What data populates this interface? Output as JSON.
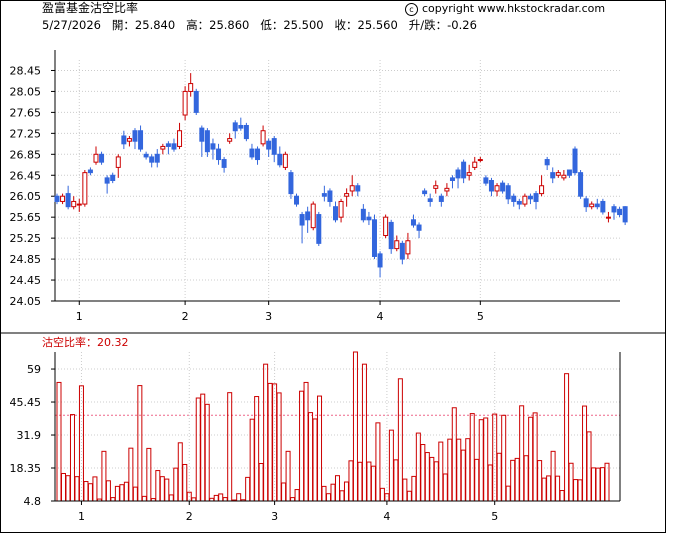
{
  "header": {
    "title": "盈富基金沽空比率",
    "copyright": "copyright www.hkstockradar.com",
    "ohlc_line": "5/27/2026   開：25.840   高：25.860   低：25.500   收：25.560   升/跌：-0.26"
  },
  "indicator": {
    "label": "沽空比率：20.32"
  },
  "colors": {
    "up": "#cc0000",
    "down": "#3366dd",
    "bar": "#cc0000",
    "grid": "#cccccc",
    "ref": "#ee6688"
  },
  "chart_data": [
    {
      "type": "candlestick",
      "title": "盈富基金沽空比率",
      "x_tick_labels": [
        "1",
        "2",
        "3",
        "4",
        "5"
      ],
      "x_tick_index": [
        4,
        23,
        38,
        58,
        76
      ],
      "y_ticks": [
        "28.45",
        "28.05",
        "27.65",
        "27.25",
        "26.85",
        "26.45",
        "26.05",
        "25.65",
        "25.25",
        "24.85",
        "24.45",
        "24.05"
      ],
      "ylim": [
        24.05,
        28.65
      ],
      "grid": true,
      "candles": [
        [
          26.05,
          25.95,
          26.1,
          25.9
        ],
        [
          25.95,
          26.05,
          26.1,
          25.9
        ],
        [
          26.1,
          25.85,
          26.25,
          25.8
        ],
        [
          25.85,
          25.95,
          26.05,
          25.8
        ],
        [
          25.9,
          25.9,
          26.0,
          25.75
        ],
        [
          25.9,
          26.5,
          26.55,
          25.85
        ],
        [
          26.55,
          26.5,
          26.6,
          26.45
        ],
        [
          26.7,
          26.85,
          27.0,
          26.65
        ],
        [
          26.85,
          26.7,
          26.9,
          26.65
        ],
        [
          26.4,
          26.3,
          26.45,
          26.1
        ],
        [
          26.45,
          26.35,
          26.5,
          26.3
        ],
        [
          26.6,
          26.8,
          26.85,
          26.4
        ],
        [
          27.2,
          27.05,
          27.3,
          26.95
        ],
        [
          27.1,
          27.15,
          27.2,
          27.0
        ],
        [
          27.3,
          27.1,
          27.35,
          26.95
        ],
        [
          27.3,
          26.95,
          27.4,
          26.9
        ],
        [
          26.85,
          26.8,
          26.9,
          26.75
        ],
        [
          26.8,
          26.7,
          26.85,
          26.6
        ],
        [
          26.85,
          26.7,
          26.95,
          26.6
        ],
        [
          26.95,
          27.0,
          27.05,
          26.85
        ],
        [
          27.05,
          27.0,
          27.1,
          26.85
        ],
        [
          27.05,
          26.95,
          27.15,
          26.9
        ],
        [
          27.0,
          27.3,
          27.45,
          26.95
        ],
        [
          27.6,
          28.05,
          28.15,
          27.5
        ],
        [
          28.05,
          28.2,
          28.4,
          27.95
        ],
        [
          28.05,
          27.65,
          28.1,
          27.6
        ],
        [
          27.35,
          27.1,
          27.4,
          26.8
        ],
        [
          27.3,
          26.9,
          27.35,
          26.8
        ],
        [
          27.05,
          26.95,
          27.15,
          26.75
        ],
        [
          26.95,
          26.75,
          27.05,
          26.65
        ],
        [
          26.75,
          26.6,
          26.8,
          26.5
        ],
        [
          27.1,
          27.15,
          27.25,
          27.05
        ],
        [
          27.45,
          27.3,
          27.5,
          27.15
        ],
        [
          27.4,
          27.35,
          27.55,
          27.3
        ],
        [
          27.4,
          27.15,
          27.45,
          27.1
        ],
        [
          26.95,
          26.8,
          27.05,
          26.75
        ],
        [
          26.95,
          26.75,
          27.0,
          26.65
        ],
        [
          27.05,
          27.3,
          27.4,
          27.0
        ],
        [
          27.1,
          26.95,
          27.15,
          26.8
        ],
        [
          27.15,
          26.85,
          27.2,
          26.7
        ],
        [
          26.85,
          26.65,
          27.0,
          26.6
        ],
        [
          26.6,
          26.85,
          26.9,
          26.55
        ],
        [
          26.5,
          26.1,
          26.55,
          26.0
        ],
        [
          26.05,
          25.9,
          26.1,
          25.85
        ],
        [
          25.7,
          25.5,
          25.75,
          25.15
        ],
        [
          25.75,
          25.6,
          25.85,
          25.35
        ],
        [
          25.45,
          25.9,
          25.95,
          25.4
        ],
        [
          25.7,
          25.15,
          25.75,
          25.1
        ],
        [
          26.1,
          26.05,
          26.25,
          25.95
        ],
        [
          26.15,
          25.95,
          26.2,
          25.85
        ],
        [
          25.85,
          25.6,
          25.95,
          25.55
        ],
        [
          25.65,
          25.95,
          26.0,
          25.55
        ],
        [
          26.05,
          26.1,
          26.2,
          25.85
        ],
        [
          26.15,
          26.25,
          26.45,
          26.05
        ],
        [
          26.25,
          26.15,
          26.3,
          26.05
        ],
        [
          25.8,
          25.6,
          25.9,
          25.55
        ],
        [
          25.65,
          25.6,
          25.75,
          25.5
        ],
        [
          25.6,
          24.9,
          25.7,
          24.85
        ],
        [
          24.95,
          24.7,
          25.0,
          24.5
        ],
        [
          25.3,
          25.65,
          25.7,
          25.25
        ],
        [
          25.55,
          25.05,
          25.6,
          24.95
        ],
        [
          25.05,
          25.2,
          25.3,
          25.0
        ],
        [
          25.15,
          24.85,
          25.2,
          24.75
        ],
        [
          24.95,
          25.2,
          25.35,
          24.85
        ],
        [
          25.6,
          25.5,
          25.7,
          25.45
        ],
        [
          25.5,
          25.4,
          25.55,
          25.25
        ],
        [
          26.15,
          26.1,
          26.2,
          26.05
        ],
        [
          26.0,
          25.95,
          26.1,
          25.85
        ],
        [
          26.2,
          26.25,
          26.35,
          26.1
        ],
        [
          26.05,
          25.95,
          26.1,
          25.85
        ],
        [
          26.15,
          26.2,
          26.3,
          26.05
        ],
        [
          26.4,
          26.35,
          26.45,
          26.2
        ],
        [
          26.55,
          26.4,
          26.6,
          26.2
        ],
        [
          26.7,
          26.4,
          26.75,
          26.3
        ],
        [
          26.45,
          26.5,
          26.65,
          26.35
        ],
        [
          26.6,
          26.7,
          26.8,
          26.55
        ],
        [
          26.75,
          26.75,
          26.8,
          26.7
        ],
        [
          26.4,
          26.3,
          26.45,
          26.25
        ],
        [
          26.35,
          26.15,
          26.4,
          26.05
        ],
        [
          26.15,
          26.25,
          26.3,
          26.05
        ],
        [
          26.3,
          26.15,
          26.35,
          26.1
        ],
        [
          26.25,
          26.0,
          26.3,
          25.9
        ],
        [
          26.05,
          25.95,
          26.1,
          25.85
        ],
        [
          25.95,
          25.9,
          26.0,
          25.8
        ],
        [
          25.9,
          26.05,
          26.1,
          25.85
        ],
        [
          26.05,
          26.0,
          26.1,
          25.9
        ],
        [
          26.1,
          25.95,
          26.15,
          25.8
        ],
        [
          26.1,
          26.25,
          26.45,
          26.05
        ],
        [
          26.75,
          26.65,
          26.8,
          26.55
        ],
        [
          26.5,
          26.4,
          26.6,
          26.3
        ],
        [
          26.45,
          26.5,
          26.55,
          26.4
        ],
        [
          26.4,
          26.45,
          26.55,
          26.35
        ],
        [
          26.55,
          26.45,
          26.55,
          26.4
        ],
        [
          26.95,
          26.5,
          27.0,
          26.45
        ],
        [
          26.5,
          26.05,
          26.55,
          26.0
        ],
        [
          26.0,
          25.85,
          26.05,
          25.75
        ],
        [
          25.85,
          25.9,
          25.95,
          25.8
        ],
        [
          25.9,
          25.85,
          26.0,
          25.8
        ],
        [
          25.95,
          25.75,
          26.0,
          25.7
        ],
        [
          25.65,
          25.65,
          25.75,
          25.55
        ],
        [
          25.85,
          25.75,
          25.9,
          25.6
        ],
        [
          25.8,
          25.7,
          25.85,
          25.65
        ],
        [
          25.85,
          25.56,
          25.86,
          25.5
        ]
      ]
    },
    {
      "type": "bar",
      "title": "沽空比率",
      "x_tick_labels": [
        "1",
        "2",
        "3",
        "4",
        "5"
      ],
      "y_ticks": [
        "59",
        "45.45",
        "31.9",
        "18.35",
        "4.8"
      ],
      "ylim": [
        4.8,
        66
      ],
      "reference_line": 40,
      "values": [
        53.5,
        16.1,
        15.2,
        40.3,
        14.8,
        52.1,
        12.8,
        11.9,
        14.7,
        5.6,
        25.2,
        13.1,
        6.2,
        10.8,
        11.5,
        12.5,
        26.5,
        10.5,
        52.2,
        6.7,
        26.4,
        5.8,
        17.3,
        14.8,
        13.8,
        7.3,
        18.3,
        28.7,
        19.8,
        8.4,
        6.1,
        47.1,
        48.7,
        44.5,
        5.9,
        7.1,
        7.7,
        6.2,
        49.3,
        5.2,
        7.8,
        5.3,
        14.5,
        38.4,
        47.7,
        20.2,
        61.0,
        53.1,
        52.9,
        49.2,
        12.2,
        25.2,
        6.2,
        9.5,
        49.9,
        53.5,
        41.1,
        38.5,
        47.9,
        10.8,
        7.8,
        11.7,
        15.2,
        9.0,
        12.6,
        21.3,
        66.0,
        20.7,
        61.0,
        20.8,
        19.1,
        36.9,
        10.0,
        7.8,
        33.9,
        21.7,
        55.0,
        13.8,
        8.8,
        14.9,
        32.7,
        28.0,
        24.7,
        22.7,
        20.9,
        29.0,
        15.9,
        30.2,
        43.1,
        30.2,
        25.7,
        30.4,
        40.7,
        21.9,
        38.2,
        38.9,
        19.6,
        40.5,
        24.4,
        40.0,
        10.9,
        21.5,
        22.3,
        43.9,
        23.4,
        39.2,
        41.0,
        21.4,
        14.2,
        15.1,
        25.2,
        15.0,
        9.1,
        57.1,
        20.3,
        13.6,
        13.5,
        43.8,
        33.2,
        18.4,
        18.3,
        18.5,
        20.3
      ]
    }
  ]
}
